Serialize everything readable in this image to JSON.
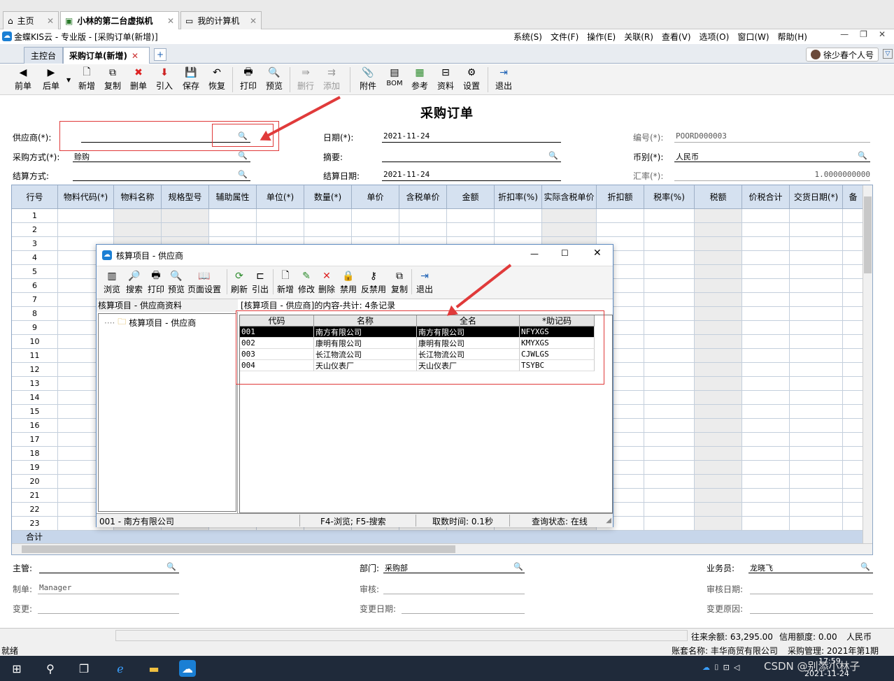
{
  "vm_tabs": [
    {
      "label": "主页"
    },
    {
      "label": "小林的第二台虚拟机"
    },
    {
      "label": "我的计算机"
    }
  ],
  "app": {
    "title": "金蝶KIS云 - 专业版 - [采购订单(新增)]",
    "menus": [
      "系统(S)",
      "文件(F)",
      "操作(E)",
      "关联(R)",
      "查看(V)",
      "选项(O)",
      "窗口(W)",
      "帮助(H)"
    ]
  },
  "doc_tabs": [
    {
      "label": "主控台"
    },
    {
      "label": "采购订单(新增)"
    }
  ],
  "user": {
    "name": "徐少春个人号"
  },
  "toolbar": {
    "buttons": [
      "前单",
      "后单",
      "新增",
      "复制",
      "删单",
      "引入",
      "保存",
      "恢复",
      "打印",
      "预览",
      "删行",
      "添加",
      "附件",
      "BOM",
      "参考",
      "资料",
      "设置",
      "退出"
    ]
  },
  "form": {
    "title": "采购订单",
    "supplier_label": "供应商(*):",
    "supplier_value": "",
    "date_label": "日期(*):",
    "date_value": "2021-11-24",
    "number_label": "编号(*):",
    "number_value": "POORD000003",
    "purchase_method_label": "采购方式(*):",
    "purchase_method_value": "赊购",
    "summary_label": "摘要:",
    "currency_label": "币别(*):",
    "currency_value": "人民币",
    "settle_method_label": "结算方式:",
    "settle_date_label": "结算日期:",
    "settle_date_value": "2021-11-24",
    "rate_label": "汇率(*):",
    "rate_value": "1.0000000000"
  },
  "grid": {
    "columns": [
      "行号",
      "物料代码(*)",
      "物料名称",
      "规格型号",
      "辅助属性",
      "单位(*)",
      "数量(*)",
      "单价",
      "含税单价",
      "金额",
      "折扣率(%)",
      "实际含税单价",
      "折扣额",
      "税率(%)",
      "税额",
      "价税合计",
      "交货日期(*)",
      "备"
    ],
    "rows": [
      "1",
      "2",
      "3",
      "4",
      "5",
      "6",
      "7",
      "8",
      "9",
      "10",
      "11",
      "12",
      "13",
      "14",
      "15",
      "16",
      "17",
      "18",
      "19",
      "20",
      "21",
      "22",
      "23"
    ],
    "total_label": "合计"
  },
  "footer": {
    "manager_label": "主管:",
    "dept_label": "部门:",
    "dept_value": "采购部",
    "salesman_label": "业务员:",
    "salesman_value": "龙晓飞",
    "maker_label": "制单:",
    "maker_value": "Manager",
    "audit_label": "审核:",
    "audit_date_label": "审核日期:",
    "change_label": "变更:",
    "change_date_label": "变更日期:",
    "change_reason_label": "变更原因:"
  },
  "status": {
    "balance": "往来余额: 63,295.00",
    "credit": "信用额度: 0.00",
    "currency": "人民币",
    "ready": "就绪",
    "account": "账套名称: 丰华商贸有限公司",
    "period": "采购管理: 2021年第1期"
  },
  "taskbar": {
    "time": "17:59",
    "date": "2021-11-24",
    "watermark": "CSDN @别添小林子"
  },
  "dialog": {
    "title": "核算项目 - 供应商",
    "toolbar": [
      "浏览",
      "搜索",
      "打印",
      "预览",
      "页面设置",
      "刷新",
      "引出",
      "新增",
      "修改",
      "删除",
      "禁用",
      "反禁用",
      "复制",
      "退出"
    ],
    "left_header": "核算项目 - 供应商资料",
    "tree_node": "核算项目 - 供应商",
    "right_header": "[核算项目 - 供应商]的内容-共计: 4条记录",
    "columns": [
      "代码",
      "名称",
      "全名",
      "*助记码"
    ],
    "rows": [
      {
        "code": "001",
        "name": "南方有限公司",
        "full": "南方有限公司",
        "mnemonic": "NFYXGS"
      },
      {
        "code": "002",
        "name": "康明有限公司",
        "full": "康明有限公司",
        "mnemonic": "KMYXGS"
      },
      {
        "code": "003",
        "name": "长江物流公司",
        "full": "长江物流公司",
        "mnemonic": "CJWLGS"
      },
      {
        "code": "004",
        "name": "天山仪表厂",
        "full": "天山仪表厂",
        "mnemonic": "TSYBC"
      }
    ],
    "status_selected": "001 - 南方有限公司",
    "status_keys": "F4-浏览; F5-搜索",
    "status_time": "取数时间: 0.1秒",
    "status_state": "查询状态: 在线"
  }
}
